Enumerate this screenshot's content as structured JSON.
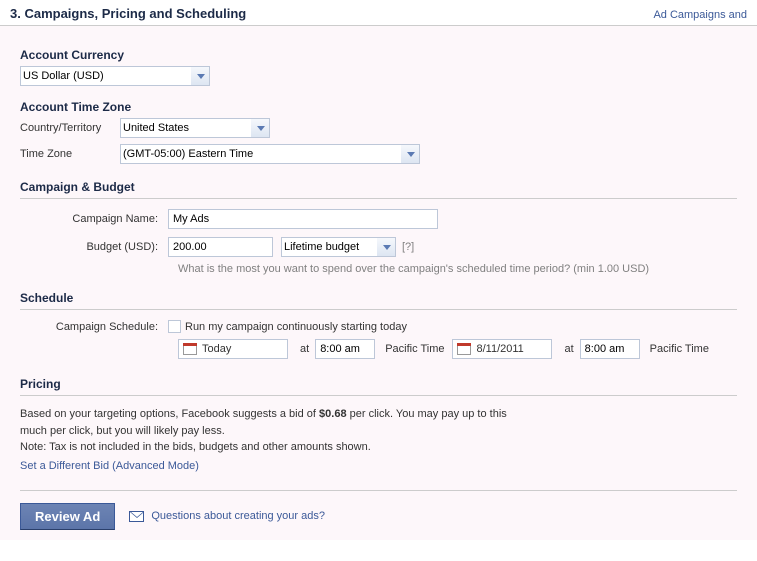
{
  "header": {
    "title": "3. Campaigns, Pricing and Scheduling",
    "right_link": "Ad Campaigns and"
  },
  "currency": {
    "title": "Account Currency",
    "selected": "US Dollar (USD)"
  },
  "timezone": {
    "title": "Account Time Zone",
    "country_label": "Country/Territory",
    "country_selected": "United States",
    "tz_label": "Time Zone",
    "tz_selected": "(GMT-05:00) Eastern Time"
  },
  "campaign": {
    "title": "Campaign & Budget",
    "name_label": "Campaign Name:",
    "name_value": "My Ads",
    "budget_label": "Budget (USD):",
    "budget_value": "200.00",
    "budget_type": "Lifetime budget",
    "help": "[?]",
    "hint": "What is the most you want to spend over the campaign's scheduled time period? (min 1.00 USD)"
  },
  "schedule": {
    "title": "Schedule",
    "label": "Campaign Schedule:",
    "continuous": "Run my campaign continuously starting today",
    "start_date": "Today",
    "start_time": "8:00 am",
    "at": "at",
    "tz1": "Pacific Time",
    "end_date": "8/11/2011",
    "end_time": "8:00 am",
    "tz2": "Pacific Time"
  },
  "pricing": {
    "title": "Pricing",
    "text1_a": "Based on your targeting options, Facebook suggests a bid of ",
    "text1_b": "$0.68",
    "text1_c": " per click. You may pay up to this",
    "text2": "much per click, but you will likely pay less.",
    "text3": "Note: Tax is not included in the bids, budgets and other amounts shown.",
    "advanced": "Set a Different Bid (Advanced Mode)"
  },
  "footer": {
    "review": "Review Ad",
    "questions": "Questions about creating your ads?"
  }
}
